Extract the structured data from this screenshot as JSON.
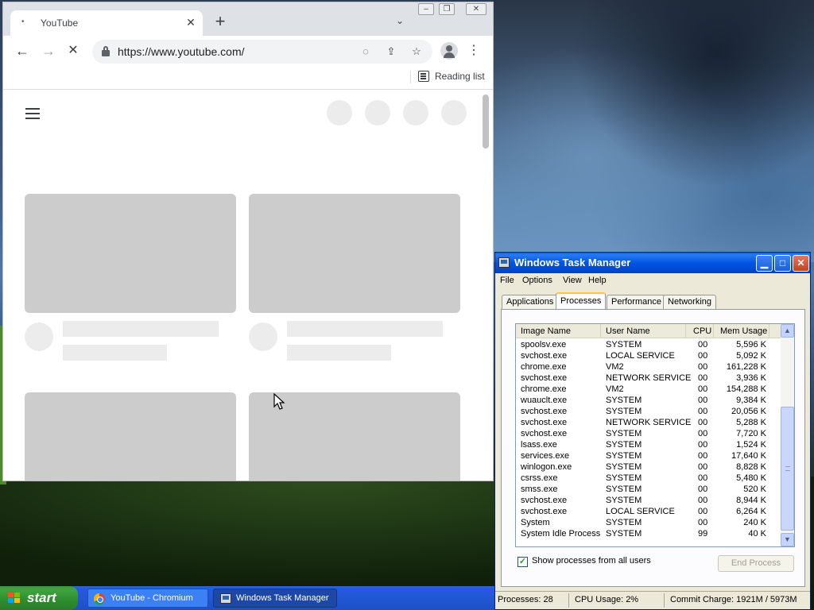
{
  "browser": {
    "tab_title": "YouTube",
    "tab_favicon": "loading-dot",
    "url": "https://www.youtube.com/",
    "reading_list_label": "Reading list"
  },
  "taskmgr": {
    "title": "Windows Task Manager",
    "menu": [
      "File",
      "Options",
      "View",
      "Help"
    ],
    "tabs": [
      "Applications",
      "Processes",
      "Performance",
      "Networking"
    ],
    "active_tab": "Processes",
    "columns": [
      "Image Name",
      "User Name",
      "CPU",
      "Mem Usage"
    ],
    "processes": [
      [
        "spoolsv.exe",
        "SYSTEM",
        "00",
        "5,596 K"
      ],
      [
        "svchost.exe",
        "LOCAL SERVICE",
        "00",
        "5,092 K"
      ],
      [
        "chrome.exe",
        "VM2",
        "00",
        "161,228 K"
      ],
      [
        "svchost.exe",
        "NETWORK SERVICE",
        "00",
        "3,936 K"
      ],
      [
        "chrome.exe",
        "VM2",
        "00",
        "154,288 K"
      ],
      [
        "wuauclt.exe",
        "SYSTEM",
        "00",
        "9,384 K"
      ],
      [
        "svchost.exe",
        "SYSTEM",
        "00",
        "20,056 K"
      ],
      [
        "svchost.exe",
        "NETWORK SERVICE",
        "00",
        "5,288 K"
      ],
      [
        "svchost.exe",
        "SYSTEM",
        "00",
        "7,720 K"
      ],
      [
        "lsass.exe",
        "SYSTEM",
        "00",
        "1,524 K"
      ],
      [
        "services.exe",
        "SYSTEM",
        "00",
        "17,640 K"
      ],
      [
        "winlogon.exe",
        "SYSTEM",
        "00",
        "8,828 K"
      ],
      [
        "csrss.exe",
        "SYSTEM",
        "00",
        "5,480 K"
      ],
      [
        "smss.exe",
        "SYSTEM",
        "00",
        "520 K"
      ],
      [
        "svchost.exe",
        "SYSTEM",
        "00",
        "8,944 K"
      ],
      [
        "svchost.exe",
        "LOCAL SERVICE",
        "00",
        "6,264 K"
      ],
      [
        "System",
        "SYSTEM",
        "00",
        "240 K"
      ],
      [
        "System Idle Process",
        "SYSTEM",
        "99",
        "40 K"
      ]
    ],
    "show_all_label": "Show processes from all users",
    "show_all_checked": true,
    "end_process_label": "End Process",
    "status": {
      "processes": "Processes: 28",
      "cpu": "CPU Usage: 2%",
      "commit": "Commit Charge: 1921M / 5973M"
    }
  },
  "taskbar": {
    "start_label": "start",
    "items": [
      "YouTube - Chromium",
      "Windows Task Manager"
    ]
  }
}
